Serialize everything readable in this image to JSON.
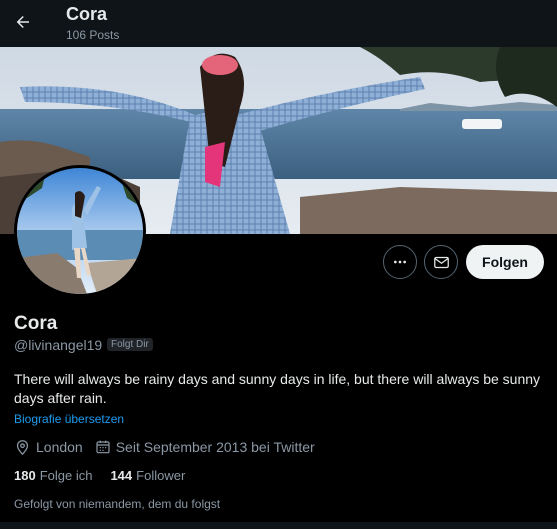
{
  "header": {
    "title": "Cora",
    "posts_count": "106 Posts"
  },
  "profile": {
    "name": "Cora",
    "handle": "@livinangel19",
    "follows_you_badge": "Folgt Dir",
    "bio": "There will always be rainy days and sunny days in life, but there will always be sunny days after rain.",
    "translate_link": "Biografie übersetzen",
    "location": "London",
    "joined": "Seit September 2013 bei Twitter",
    "following_count": "180",
    "following_label": "Folge ich",
    "followers_count": "144",
    "followers_label": "Follower",
    "followed_by": "Gefolgt von niemandem, dem du folgst"
  },
  "actions": {
    "more_icon": "more-horizontal-icon",
    "message_icon": "envelope-icon",
    "follow_label": "Folgen"
  },
  "colors": {
    "background": "#000000",
    "text_primary": "#e7e9ea",
    "text_secondary": "#8b98a5",
    "link": "#1d9bf0",
    "button_light": "#eff3f4"
  }
}
